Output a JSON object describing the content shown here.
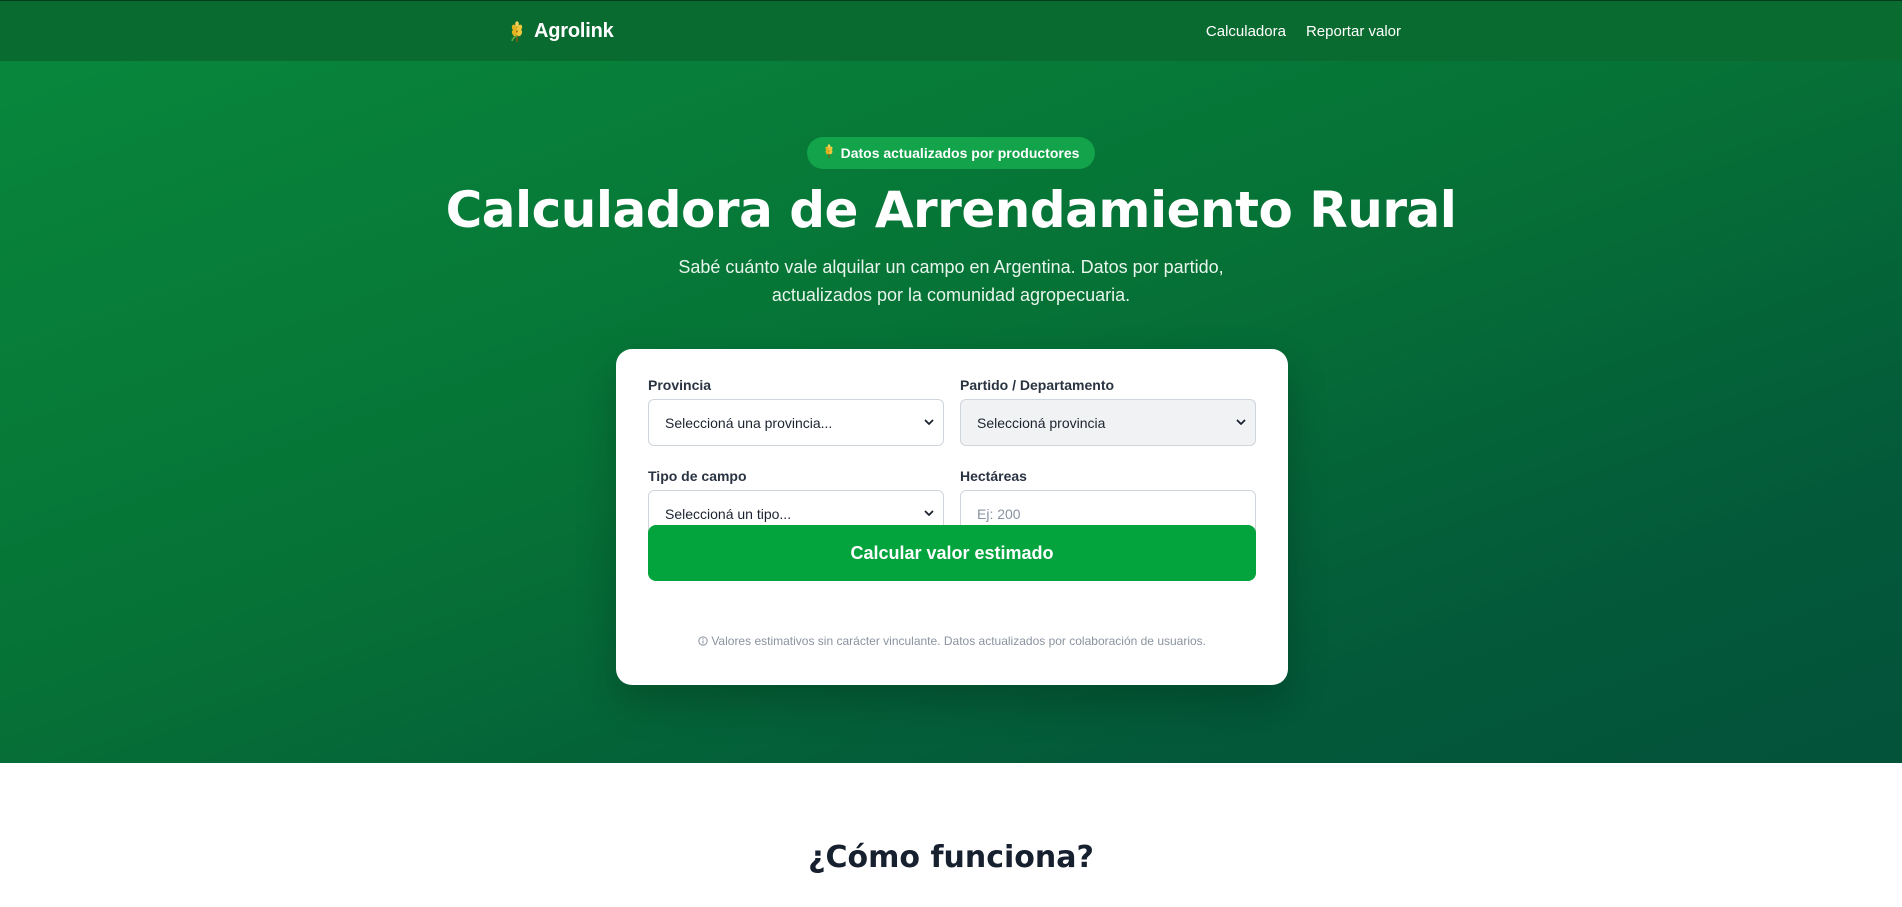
{
  "header": {
    "brand": "Agrolink",
    "nav": [
      {
        "label": "Calculadora"
      },
      {
        "label": "Reportar valor"
      }
    ]
  },
  "hero": {
    "badge": "Datos actualizados por productores",
    "title": "Calculadora de Arrendamiento Rural",
    "subtitle": "Sabé cuánto vale alquilar un campo en Argentina. Datos por partido, actualizados por la comunidad agropecuaria."
  },
  "form": {
    "provincia": {
      "label": "Provincia",
      "value": "Seleccioná una provincia..."
    },
    "partido": {
      "label": "Partido / Departamento",
      "value": "Seleccioná provincia"
    },
    "tipo": {
      "label": "Tipo de campo",
      "value": "Seleccioná un tipo..."
    },
    "hectareas": {
      "label": "Hectáreas",
      "value": "",
      "placeholder": "Ej: 200"
    },
    "submit_label": "Calcular valor estimado",
    "disclaimer": "Valores estimativos sin carácter vinculante. Datos actualizados por colaboración de usuarios."
  },
  "how": {
    "title": "¿Cómo funciona?"
  },
  "colors": {
    "header_bg": "#0a6b30",
    "hero_start": "#08873c",
    "hero_end": "#03523a",
    "badge_bg": "#13a34b",
    "button_bg": "#03a43d"
  },
  "icons": {
    "brand": "wheat-icon",
    "badge": "wheat-icon",
    "disclaimer": "info-icon",
    "select": "chevron-down-icon"
  }
}
